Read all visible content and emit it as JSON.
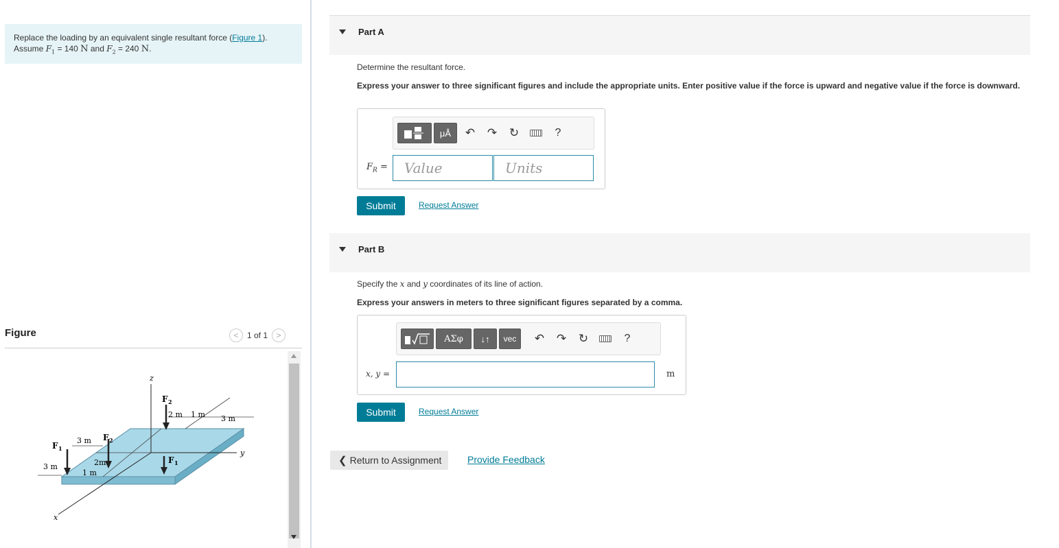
{
  "problem": {
    "text_prefix": "Replace the loading by an equivalent single resultant force (",
    "figure_link": "Figure 1",
    "text_suffix": ").",
    "assume_label": "Assume",
    "f1_sym": "F",
    "f1_sub": "1",
    "f1_value": " = 140 ",
    "f1_unit": "N",
    "and_word": " and ",
    "f2_sym": "F",
    "f2_sub": "2",
    "f2_value": " = 240 ",
    "f2_unit": "N",
    "period": "."
  },
  "figure": {
    "title": "Figure",
    "counter": "1 of 1",
    "labels": {
      "z": "z",
      "x": "x",
      "y": "y",
      "F1a": "F",
      "F1a_sub": "1",
      "F1b": "F",
      "F1b_sub": "1",
      "F2a": "F",
      "F2a_sub": "2",
      "F2b": "F",
      "F2b_sub": "2",
      "d_2m_top": "2 m",
      "d_1m_top": "1 m",
      "d_3m_top": "3 m",
      "d_3m_left": "3 m",
      "d_3m_side": "3 m",
      "d_2m_mid": "2m",
      "d_1m_bot": "1 m"
    }
  },
  "part_a": {
    "title": "Part A",
    "question": "Determine the resultant force.",
    "instructions": "Express your answer to three significant figures and include the appropriate units. Enter positive value if the force is upward and negative value if the force is downward.",
    "toolbar": {
      "units_btn": "μÅ",
      "help": "?"
    },
    "field_label_main": "F",
    "field_label_sub": "R",
    "field_label_eq": " =",
    "value_placeholder": "Value",
    "units_placeholder": "Units",
    "submit": "Submit",
    "request_answer": "Request Answer"
  },
  "part_b": {
    "title": "Part B",
    "question_prefix": "Specify the ",
    "question_x": "x",
    "question_mid": " and ",
    "question_y": "y",
    "question_suffix": " coordinates of its line of action.",
    "instructions": "Express your answers in meters to three significant figures separated by a comma.",
    "toolbar": {
      "greek_btn": "ΑΣφ",
      "arrows_btn": "↓↑",
      "vec_btn": "vec",
      "help": "?"
    },
    "field_label": "x, y =",
    "unit": "m",
    "submit": "Submit",
    "request_answer": "Request Answer"
  },
  "footer": {
    "return": "Return to Assignment",
    "feedback": "Provide Feedback"
  }
}
